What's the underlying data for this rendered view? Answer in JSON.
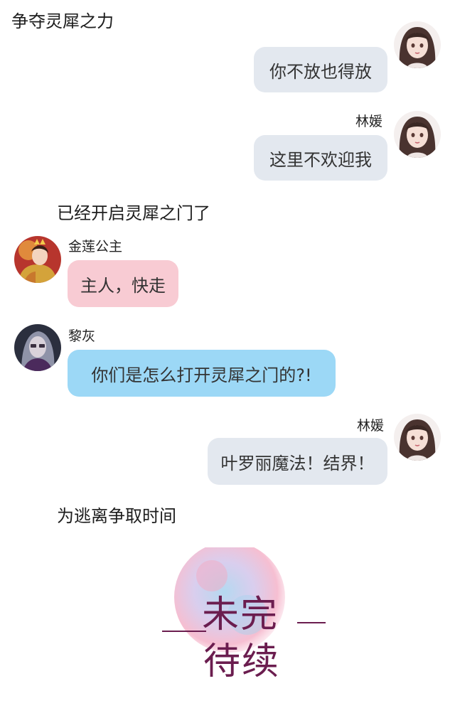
{
  "narrations": [
    "争夺灵犀之力",
    "已经开启灵犀之门了",
    "为逃离争取时间"
  ],
  "messages": [
    {
      "speaker": "",
      "text": "你不放也得放",
      "side": "right",
      "avatar": "lin-yuan-avatar",
      "color": "#e3e8ef"
    },
    {
      "speaker": "林媛",
      "text": "这里不欢迎我",
      "side": "right",
      "avatar": "lin-yuan-avatar",
      "color": "#e3e8ef"
    },
    {
      "speaker": "金莲公主",
      "text": "主人，快走",
      "side": "left",
      "avatar": "jinlian-princess-avatar",
      "color": "#f8cbd3"
    },
    {
      "speaker": "黎灰",
      "text": "你们是怎么打开灵犀之门的?!",
      "side": "left",
      "avatar": "lihui-avatar",
      "color": "#9cd8f6"
    },
    {
      "speaker": "林媛",
      "text": "叶罗丽魔法！结界！",
      "side": "right",
      "avatar": "lin-yuan-avatar",
      "color": "#e3e8ef"
    }
  ],
  "end_mark": {
    "line1": "未完",
    "line2": "待续",
    "colors": {
      "ink": "#6b1d4f",
      "watercolor_pink": "#f3a9c2",
      "watercolor_blue": "#a6d3ee"
    }
  }
}
